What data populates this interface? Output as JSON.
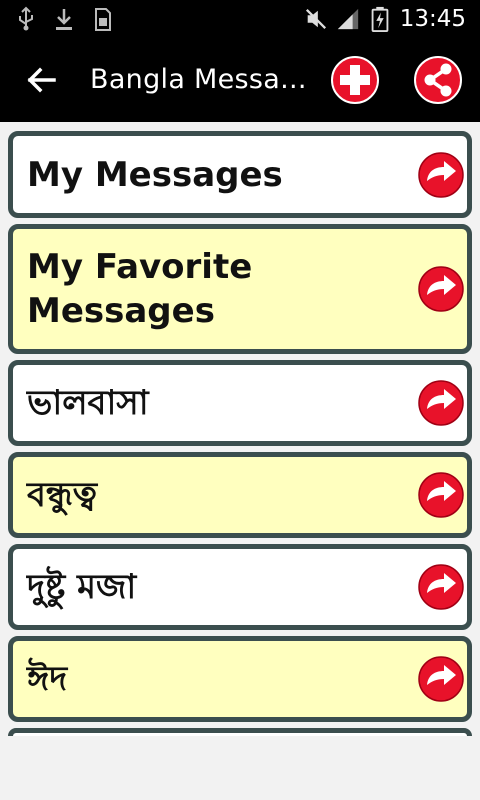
{
  "status_bar": {
    "time": "13:45"
  },
  "action_bar": {
    "title": "Bangla Messa...",
    "back_icon": "arrow-left-icon",
    "add_icon": "plus-circle-icon",
    "share_icon": "share-icon"
  },
  "colors": {
    "accent_red": "#e8122a",
    "border": "#3b4e4e",
    "yellow_bg": "#ffffbf"
  },
  "categories": [
    {
      "label": "My Messages",
      "style": "white"
    },
    {
      "label": "My Favorite Messages",
      "style": "yellow"
    },
    {
      "label": "ভালবাসা",
      "style": "white"
    },
    {
      "label": "বন্ধুত্ব",
      "style": "yellow"
    },
    {
      "label": "দুষ্টু মজা",
      "style": "white"
    },
    {
      "label": "ঈদ",
      "style": "yellow"
    }
  ]
}
